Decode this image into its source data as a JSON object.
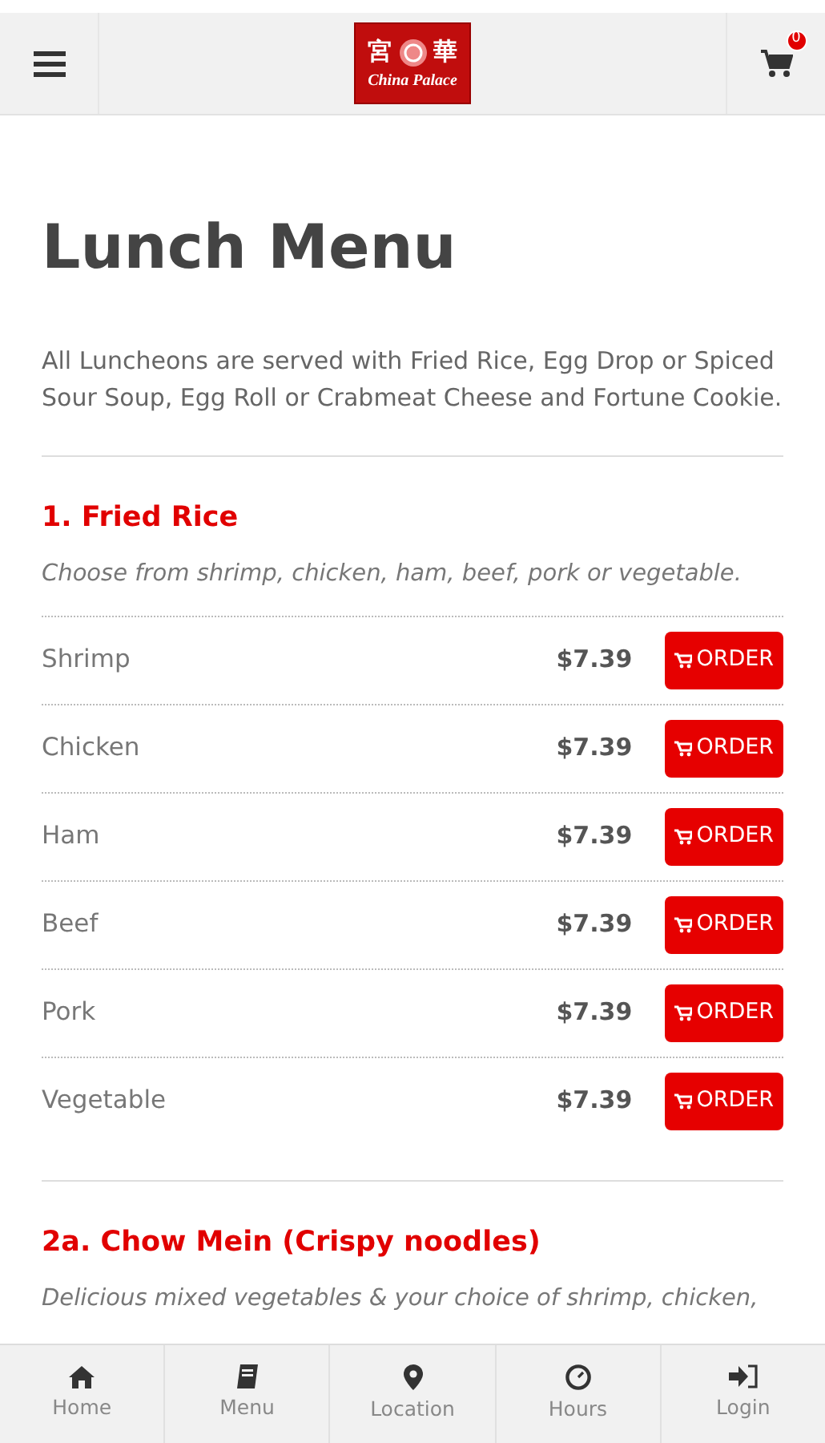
{
  "header": {
    "logo_chars": [
      "宮",
      "華"
    ],
    "logo_text": "China Palace",
    "cart_count": "0"
  },
  "title": "Lunch Menu",
  "intro": "All Luncheons are served with Fried Rice, Egg Drop or Spiced Sour Soup, Egg Roll or Crabmeat Cheese and Fortune Cookie.",
  "sections": [
    {
      "heading": "1. Fried Rice",
      "description": "Choose from shrimp, chicken, ham, beef, pork or vegetable.",
      "items": [
        {
          "name": "Shrimp",
          "price": "$7.39",
          "button": "ORDER"
        },
        {
          "name": "Chicken",
          "price": "$7.39",
          "button": "ORDER"
        },
        {
          "name": "Ham",
          "price": "$7.39",
          "button": "ORDER"
        },
        {
          "name": "Beef",
          "price": "$7.39",
          "button": "ORDER"
        },
        {
          "name": "Pork",
          "price": "$7.39",
          "button": "ORDER"
        },
        {
          "name": "Vegetable",
          "price": "$7.39",
          "button": "ORDER"
        }
      ]
    },
    {
      "heading": "2a. Chow Mein (Crispy noodles)",
      "description": "Delicious mixed vegetables & your choice of shrimp, chicken,"
    }
  ],
  "bottom_nav": [
    {
      "kind": "home",
      "label": "Home"
    },
    {
      "kind": "menu",
      "label": "Menu"
    },
    {
      "kind": "location",
      "label": "Location"
    },
    {
      "kind": "hours",
      "label": "Hours"
    },
    {
      "kind": "login",
      "label": "Login"
    }
  ]
}
